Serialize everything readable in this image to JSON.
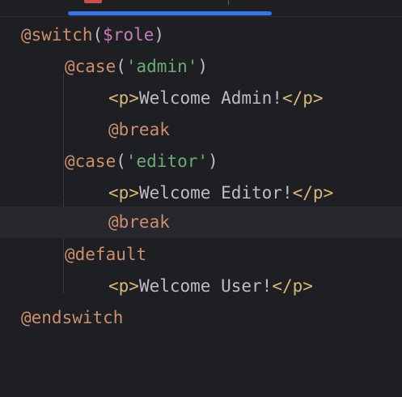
{
  "editor": {
    "lines": [
      {
        "directive": "@switch",
        "open": "(",
        "variable": "$role",
        "close": ")"
      },
      {
        "directive": "@case",
        "open": "(",
        "string": "'admin'",
        "close": ")"
      },
      {
        "tag_open": "<p>",
        "text": "Welcome Admin!",
        "tag_close": "</p>"
      },
      {
        "directive": "@break"
      },
      {
        "directive": "@case",
        "open": "(",
        "string": "'editor'",
        "close": ")"
      },
      {
        "tag_open": "<p>",
        "text": "Welcome Editor!",
        "tag_close": "</p>"
      },
      {
        "directive": "@break"
      },
      {
        "directive": "@default"
      },
      {
        "tag_open": "<p>",
        "text": "Welcome User!",
        "tag_close": "</p>"
      },
      {
        "directive": "@endswitch"
      }
    ],
    "current_line": 7
  },
  "colors": {
    "background": "#1e1f22",
    "current_line_highlight": "#26282e",
    "directive": "#cf8e6d",
    "variable": "#c77dbb",
    "string": "#6aab73",
    "html_tag": "#d5b778",
    "plain_text": "#bcbec4",
    "active_tab_underline": "#3574f0"
  }
}
